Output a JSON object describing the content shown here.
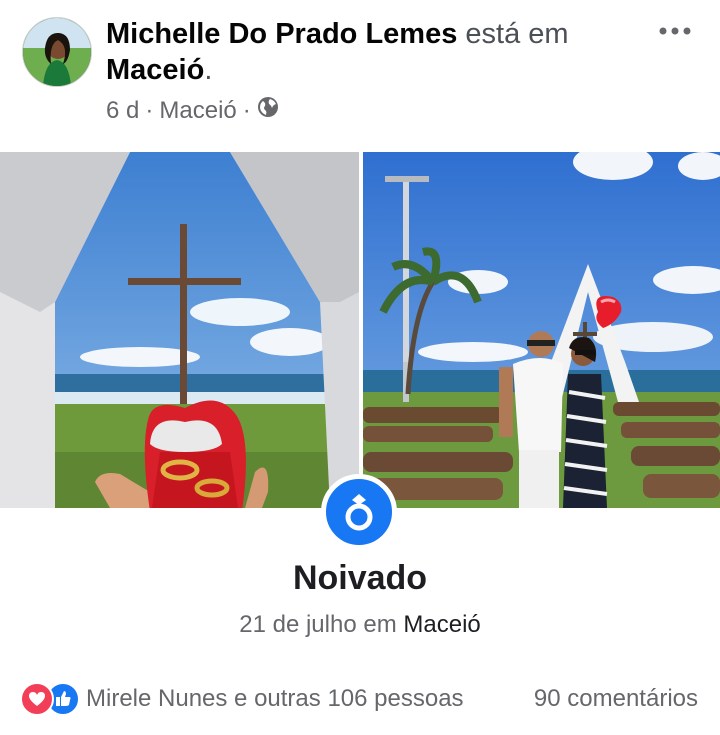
{
  "post": {
    "author": "Michelle Do Prado Lemes",
    "activity_prefix": " está em",
    "location": "Maceió",
    "location_suffix": ".",
    "time": "6 d",
    "meta_location": "Maceió",
    "separator": "·",
    "privacy_icon": "globe-icon",
    "more_icon": "more-options-icon"
  },
  "event": {
    "icon": "ring-icon",
    "title": "Noivado",
    "date_prefix": "21 de julho em",
    "place": "Maceió"
  },
  "footer": {
    "reaction_icons": [
      "love-reaction-icon",
      "like-reaction-icon"
    ],
    "reaction_summary": "Mirele Nunes e outras 106 pessoas",
    "comments": "90 comentários"
  },
  "colors": {
    "facebook_blue": "#1877f2",
    "love_red": "#f33e58",
    "muted_text": "#65676b"
  }
}
